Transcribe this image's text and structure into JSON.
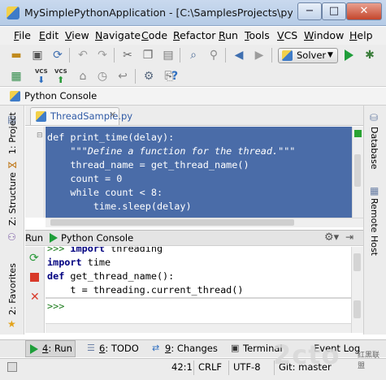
{
  "window": {
    "title": "MySimplePythonApplication - [C:\\SamplesProjects\\py\\MySim...",
    "minimize_label": "−",
    "maximize_label": "□",
    "close_label": "✕"
  },
  "menu": [
    "File",
    "Edit",
    "View",
    "Navigate",
    "Code",
    "Refactor",
    "Run",
    "Tools",
    "VCS",
    "Window",
    "Help"
  ],
  "toolbar": {
    "run_config": "Solver",
    "vcs_label": "VCS"
  },
  "navbar": {
    "breadcrumb": "Python Console"
  },
  "left_tabs": [
    "1: Project",
    "Z: Structure",
    "2: Favorites"
  ],
  "right_tabs": [
    "Database",
    "Remote Host"
  ],
  "editor": {
    "tab_label": "ThreadSample.py",
    "lines": [
      "def print_time(delay):",
      "    \"\"\"Define a function for the thread.\"\"\"",
      "    thread_name = get_thread_name()",
      "    count = 0",
      "    while count < 8:",
      "        time.sleep(delay)"
    ]
  },
  "run_panel": {
    "header_label": "Run",
    "title": "Python Console",
    "console_lines": [
      {
        "prompt": ">>> ",
        "kw": "import",
        "rest": " threading"
      },
      {
        "prompt": "",
        "kw": "import",
        "rest": " time"
      },
      {
        "prompt": "",
        "kw": "def",
        "rest": " get_thread_name():"
      },
      {
        "prompt": "",
        "kw": "",
        "rest": "    t = threading.current_thread()"
      }
    ],
    "input_prompt": ">>>"
  },
  "bottom_tabs": [
    {
      "mnemonic": "4",
      "label": ": Run"
    },
    {
      "mnemonic": "6",
      "label": ": TODO"
    },
    {
      "mnemonic": "9",
      "label": ": Changes"
    },
    {
      "mnemonic": "",
      "label": "Terminal"
    },
    {
      "mnemonic": "",
      "label": "Event Log"
    }
  ],
  "status": {
    "position": "42:1",
    "line_sep": "CRLF",
    "encoding": "UTF-8",
    "vcs": "Git: master"
  },
  "watermark": {
    "text": "2cto",
    "sub": "红黑联盟"
  },
  "colors": {
    "selection": "#4a6ca8",
    "run_green": "#1f9e3a"
  }
}
